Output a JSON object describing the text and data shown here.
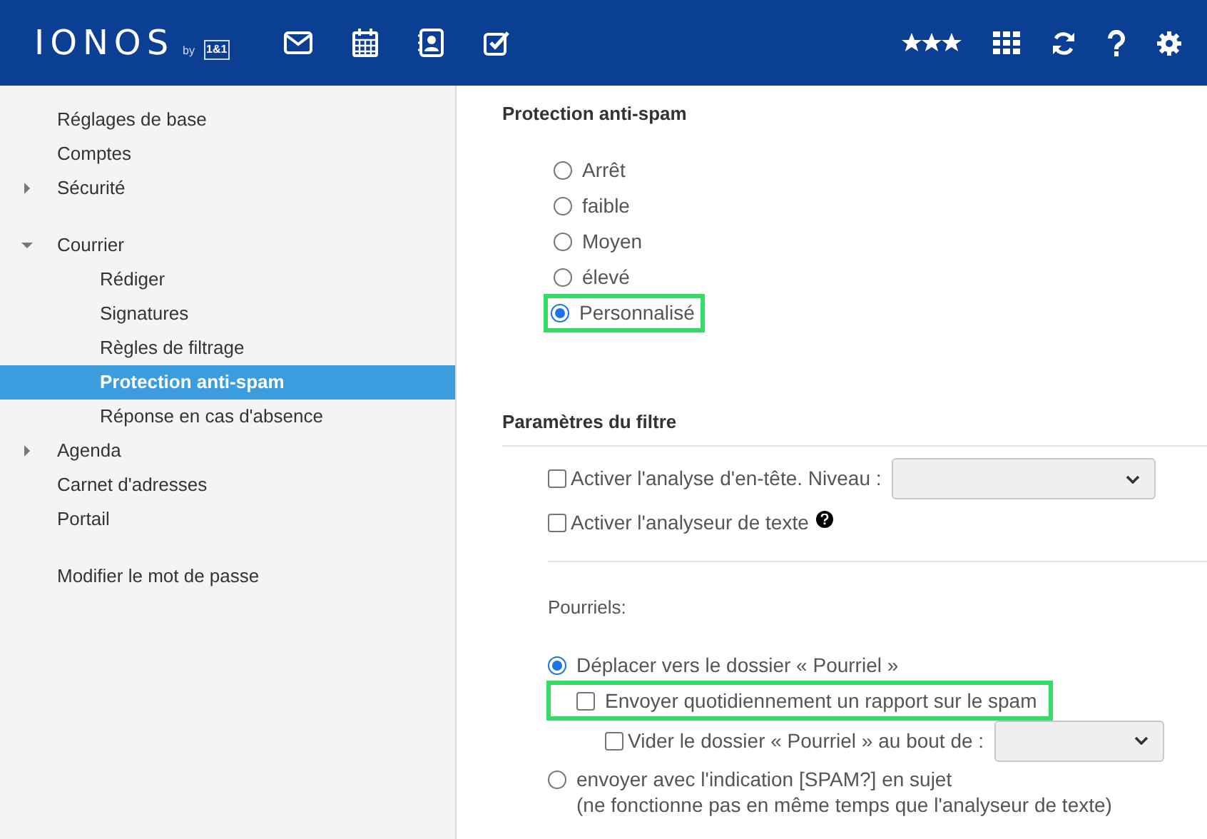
{
  "header": {
    "logo": "IONOS",
    "by": "by",
    "brand": "1&1"
  },
  "sidebar": {
    "groups": [
      {
        "items": [
          {
            "label": "Réglages de base",
            "selected": false
          },
          {
            "label": "Comptes",
            "selected": false
          },
          {
            "label": "Sécurité",
            "selected": false,
            "expanded": false
          }
        ]
      },
      {
        "items": [
          {
            "label": "Courrier",
            "selected": false,
            "expanded": true,
            "children": [
              {
                "label": "Rédiger",
                "selected": false
              },
              {
                "label": "Signatures",
                "selected": false
              },
              {
                "label": "Règles de filtrage",
                "selected": false
              },
              {
                "label": "Protection anti-spam",
                "selected": true
              },
              {
                "label": "Réponse en cas d'absence",
                "selected": false
              }
            ]
          },
          {
            "label": "Agenda",
            "selected": false,
            "expanded": false
          },
          {
            "label": "Carnet d'adresses",
            "selected": false
          },
          {
            "label": "Portail",
            "selected": false
          }
        ]
      },
      {
        "items": [
          {
            "label": "Modifier le mot de passe",
            "selected": false
          }
        ]
      }
    ]
  },
  "spam_protection": {
    "title": "Protection anti-spam",
    "levels": [
      {
        "label": "Arrêt",
        "selected": false,
        "highlighted": false
      },
      {
        "label": "faible",
        "selected": false,
        "highlighted": false
      },
      {
        "label": "Moyen",
        "selected": false,
        "highlighted": false
      },
      {
        "label": "élevé",
        "selected": false,
        "highlighted": false
      },
      {
        "label": "Personnalisé",
        "selected": true,
        "highlighted": true
      }
    ]
  },
  "filter": {
    "title": "Paramètres du filtre",
    "options": [
      {
        "kind": "select",
        "label": "Activer l'analyse d'en-tête. Niveau :",
        "checked": false
      },
      {
        "kind": "help",
        "label": "Activer l'analyseur de texte",
        "checked": false
      }
    ],
    "spam_label": "Pourriels:",
    "actions": [
      {
        "label": "Déplacer vers le dossier « Pourriel »",
        "selected": true,
        "children": [
          {
            "kind": "plain",
            "label": "Envoyer quotidiennement un rapport sur le spam",
            "checked": false,
            "highlighted": true
          },
          {
            "kind": "select",
            "label": "Vider le dossier « Pourriel » au bout de :",
            "checked": false,
            "highlighted": false
          }
        ]
      },
      {
        "label": "envoyer avec l'indication [SPAM?] en sujet",
        "selected": false,
        "note": "(ne fonctionne pas en même temps que l'analyseur de texte)"
      }
    ]
  }
}
